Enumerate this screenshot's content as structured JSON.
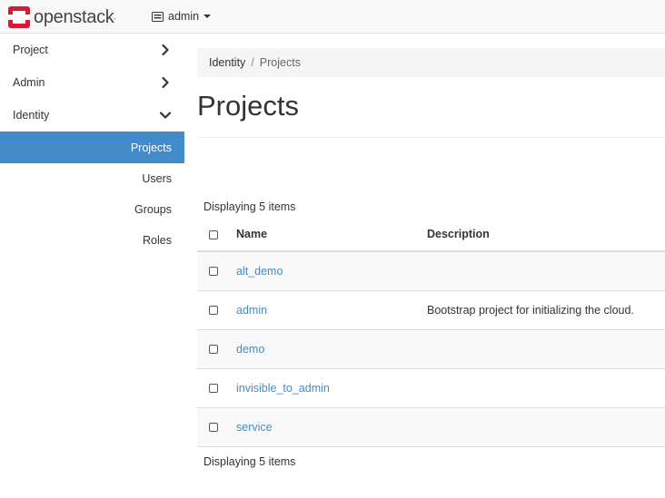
{
  "navbar": {
    "brand": "openstack",
    "brand_mark": ".",
    "project_label": "admin"
  },
  "sidebar": {
    "panels": [
      {
        "label": "Project",
        "expanded": false
      },
      {
        "label": "Admin",
        "expanded": false
      },
      {
        "label": "Identity",
        "expanded": true
      }
    ],
    "items": [
      {
        "label": "Projects",
        "active": true
      },
      {
        "label": "Users",
        "active": false
      },
      {
        "label": "Groups",
        "active": false
      },
      {
        "label": "Roles",
        "active": false
      }
    ]
  },
  "breadcrumb": {
    "parent": "Identity",
    "separator": "/",
    "current": "Projects"
  },
  "page": {
    "title": "Projects",
    "count_text": "Displaying 5 items"
  },
  "table": {
    "headers": {
      "name": "Name",
      "description": "Description"
    },
    "rows": [
      {
        "name": "alt_demo",
        "description": ""
      },
      {
        "name": "admin",
        "description": "Bootstrap project for initializing the cloud."
      },
      {
        "name": "demo",
        "description": ""
      },
      {
        "name": "invisible_to_admin",
        "description": ""
      },
      {
        "name": "service",
        "description": ""
      }
    ]
  },
  "colors": {
    "accent": "#428bca",
    "brand_red": "#da1a32",
    "navbar_bg": "#f8f8f8",
    "breadcrumb_bg": "#f5f5f5"
  },
  "icons": {
    "brand_logo": "openstack-logo-icon",
    "project_switch": "server-icon",
    "panel_collapsed": "chevron-right-icon",
    "panel_expanded": "chevron-down-icon"
  }
}
